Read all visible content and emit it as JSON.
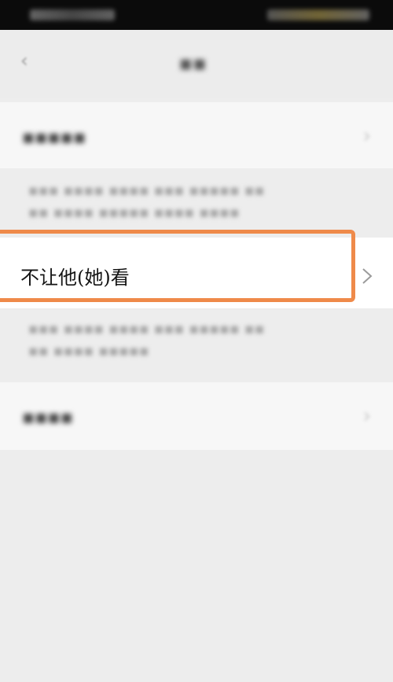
{
  "nav": {
    "back_icon": "chevron-left-icon"
  },
  "rows": {
    "hide_their_moments": {
      "chevron_icon": "chevron-right-icon"
    },
    "hide_my_moments": {
      "label": "不让他(她)看",
      "chevron_icon": "chevron-right-icon"
    },
    "complaint": {
      "chevron_icon": "chevron-right-icon"
    }
  },
  "colors": {
    "highlight_border": "#ef8a4a",
    "background": "#ededed",
    "cell_background": "#ffffff",
    "status_bar": "#0b0b0b"
  }
}
